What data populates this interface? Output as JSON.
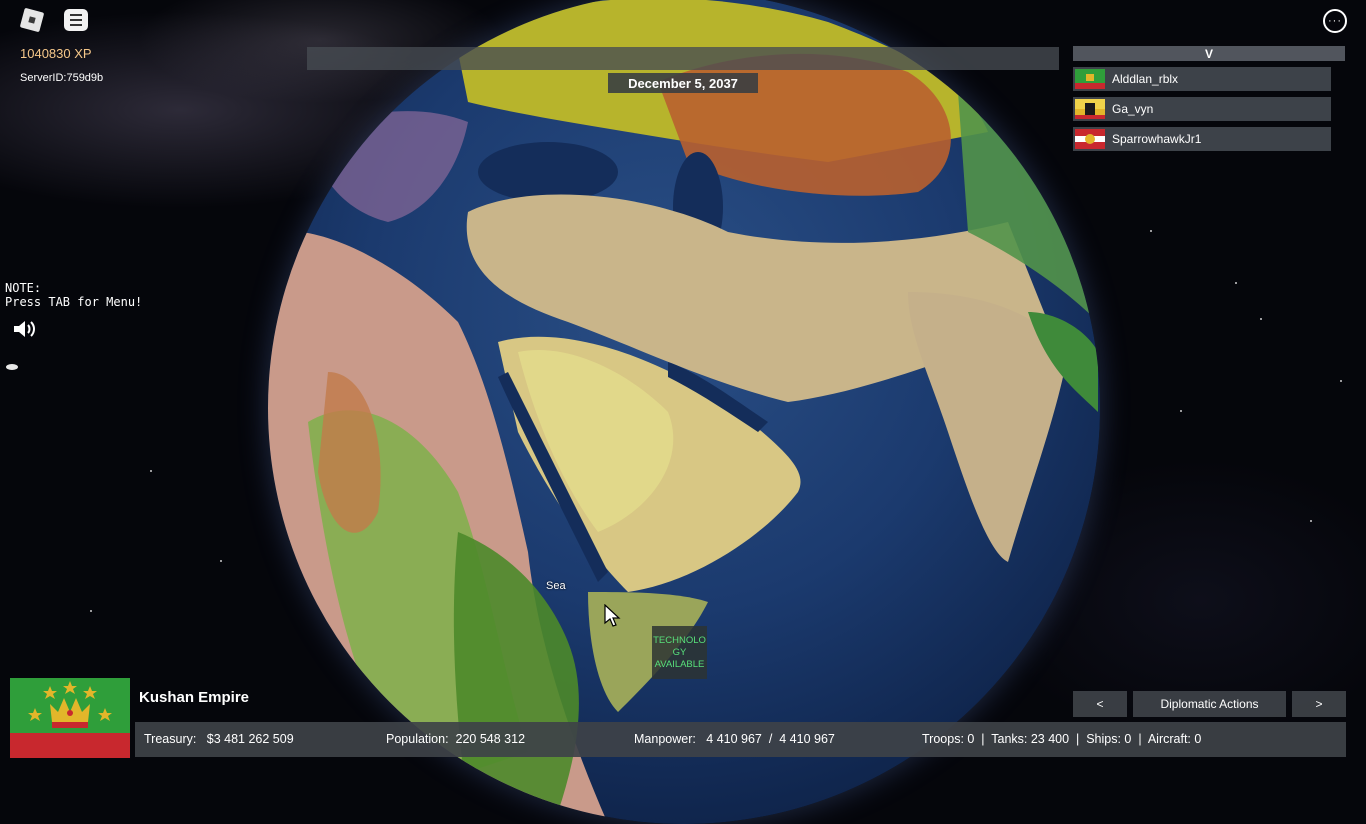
{
  "hud": {
    "xp": "1040830 XP",
    "server_id": "ServerID:759d9b",
    "note_line1": "NOTE:",
    "note_line2": "Press TAB for Menu!"
  },
  "date": "December 5, 2037",
  "players": {
    "header": "V",
    "list": [
      {
        "name": "Alddlan_rblx"
      },
      {
        "name": "Ga_vyn"
      },
      {
        "name": "SparrowhawkJr1"
      }
    ]
  },
  "map": {
    "sea_label": "Sea",
    "tech_notice": "TECHNOLO GY AVAILABLE"
  },
  "country": {
    "name": "Kushan Empire",
    "stats": {
      "treasury_label": "Treasury:",
      "treasury_value": "$3 481 262 509",
      "population_label": "Population:",
      "population_value": "220 548 312",
      "manpower_label": "Manpower:",
      "manpower_value": "4 410 967  /  4 410 967",
      "military": "Troops: 0  |  Tanks: 23 400  |  Ships: 0  |  Aircraft: 0"
    }
  },
  "nav": {
    "prev": "<",
    "title": "Diplomatic Actions",
    "next": ">"
  },
  "colors": {
    "xp_text": "#f6c88a",
    "panel_bg": "#3e4248",
    "tech_text": "#58e07a",
    "flag_green": "#2f9e3a",
    "flag_red": "#c8282e",
    "crown_gold": "#e2b62a"
  },
  "icons": {
    "roblox_logo": "roblox-icon",
    "chat": "chat-icon",
    "more": "more-options-icon",
    "sound": "speaker-icon",
    "cursor": "mouse-cursor-icon"
  }
}
